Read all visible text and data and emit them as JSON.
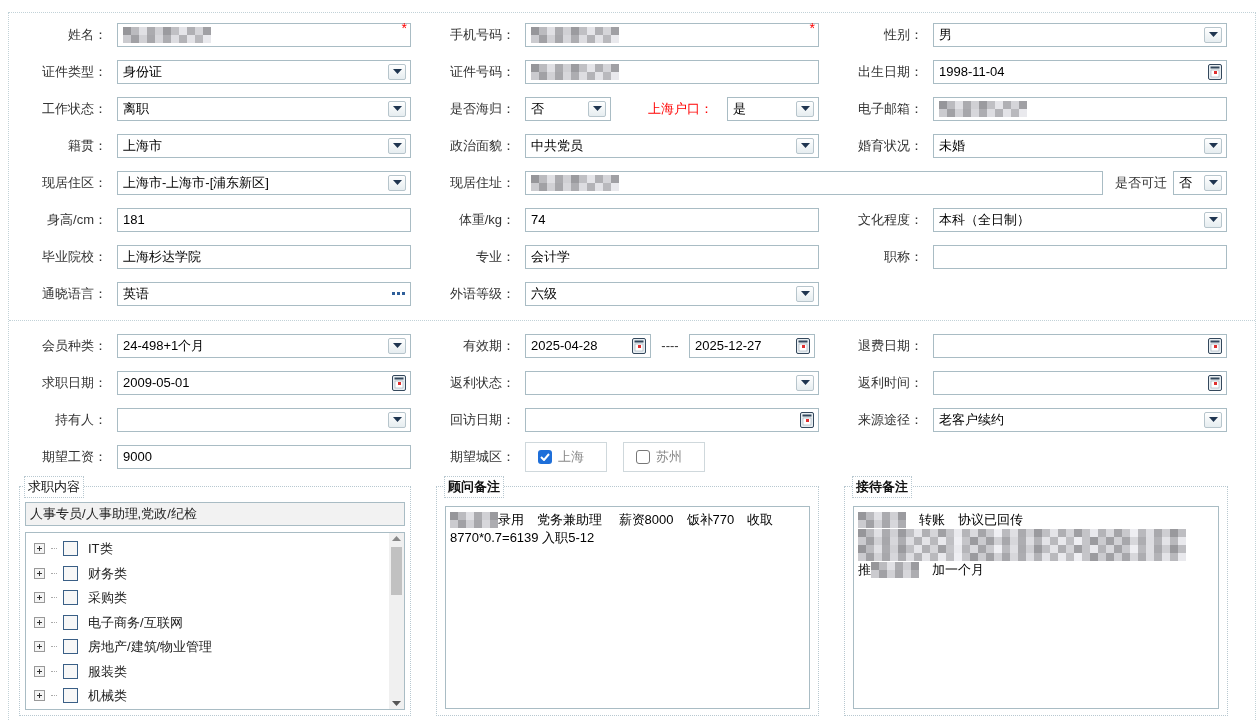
{
  "sections": [
    {
      "rows": [
        {
          "cells": [
            {
              "kind": "normal",
              "label": "姓名：",
              "field": {
                "kind": "text",
                "redacted": true,
                "required_mark": "*"
              }
            },
            {
              "kind": "normal",
              "label": "手机号码：",
              "field": {
                "kind": "text",
                "redacted": true,
                "required_mark": "*"
              }
            },
            {
              "kind": "normal",
              "label": "性别：",
              "field": {
                "kind": "select",
                "value": "男"
              }
            }
          ]
        },
        {
          "cells": [
            {
              "kind": "normal",
              "label": "证件类型：",
              "field": {
                "kind": "select",
                "value": "身份证"
              }
            },
            {
              "kind": "normal",
              "label": "证件号码：",
              "field": {
                "kind": "text",
                "redacted": true
              }
            },
            {
              "kind": "normal",
              "label": "出生日期：",
              "field": {
                "kind": "date",
                "value": "1998-11-04"
              }
            }
          ]
        },
        {
          "cells": [
            {
              "kind": "normal",
              "label": "工作状态：",
              "field": {
                "kind": "select",
                "value": "离职"
              }
            },
            {
              "kind": "pair",
              "label": "是否海归：",
              "field": {
                "kind": "select",
                "value": "否"
              },
              "label2": "上海户口：",
              "highlight2": true,
              "field2": {
                "kind": "select",
                "value": "是"
              }
            },
            {
              "kind": "normal",
              "label": "电子邮箱：",
              "field": {
                "kind": "text",
                "redacted": true
              }
            }
          ]
        },
        {
          "cells": [
            {
              "kind": "normal",
              "label": "籍贯：",
              "field": {
                "kind": "select",
                "value": "上海市"
              }
            },
            {
              "kind": "normal",
              "label": "政治面貌：",
              "field": {
                "kind": "select",
                "value": "中共党员"
              }
            },
            {
              "kind": "normal",
              "label": "婚育状况：",
              "field": {
                "kind": "select",
                "value": "未婚"
              }
            }
          ]
        },
        {
          "cells": [
            {
              "kind": "normal",
              "label": "现居住区：",
              "field": {
                "kind": "select",
                "value": "上海市-上海市-[浦东新区]"
              }
            },
            {
              "kind": "address",
              "label": "现居住址：",
              "field": {
                "kind": "text",
                "redacted": true
              },
              "label2": "是否可迁",
              "highlight2": false,
              "field2": {
                "kind": "select",
                "value": "否"
              }
            }
          ]
        },
        {
          "cells": [
            {
              "kind": "normal",
              "label": "身高/cm：",
              "field": {
                "kind": "text",
                "value": "181"
              }
            },
            {
              "kind": "normal",
              "label": "体重/kg：",
              "field": {
                "kind": "text",
                "value": "74"
              }
            },
            {
              "kind": "normal",
              "label": "文化程度：",
              "field": {
                "kind": "select",
                "value": "本科（全日制）"
              }
            }
          ]
        },
        {
          "cells": [
            {
              "kind": "normal",
              "label": "毕业院校：",
              "field": {
                "kind": "text",
                "value": "上海杉达学院"
              }
            },
            {
              "kind": "normal",
              "label": "专业：",
              "field": {
                "kind": "text",
                "value": "会计学"
              }
            },
            {
              "kind": "normal",
              "label": "职称：",
              "field": {
                "kind": "text"
              }
            }
          ]
        },
        {
          "cells": [
            {
              "kind": "normal",
              "label": "通晓语言：",
              "field": {
                "kind": "lookup",
                "value": "英语"
              }
            },
            {
              "kind": "normal",
              "label": "外语等级：",
              "field": {
                "kind": "select",
                "value": "六级"
              }
            }
          ]
        }
      ]
    },
    {
      "rows": [
        {
          "cells": [
            {
              "kind": "normal",
              "label": "会员种类：",
              "field": {
                "kind": "select",
                "value": "24-498+1个月"
              }
            },
            {
              "kind": "range",
              "label": "有效期：",
              "field": {
                "kind": "date",
                "value": "2025-04-28"
              },
              "separator": "----",
              "field2": {
                "kind": "date",
                "value": "2025-12-27"
              }
            },
            {
              "kind": "normal",
              "label": "退费日期：",
              "field": {
                "kind": "date"
              }
            }
          ]
        },
        {
          "cells": [
            {
              "kind": "normal",
              "label": "求职日期：",
              "field": {
                "kind": "date",
                "value": "2009-05-01"
              }
            },
            {
              "kind": "normal",
              "label": "返利状态：",
              "field": {
                "kind": "select"
              }
            },
            {
              "kind": "normal",
              "label": "返利时间：",
              "field": {
                "kind": "date"
              }
            }
          ]
        },
        {
          "cells": [
            {
              "kind": "normal",
              "label": "持有人：",
              "field": {
                "kind": "select"
              }
            },
            {
              "kind": "normal",
              "label": "回访日期：",
              "field": {
                "kind": "date"
              }
            },
            {
              "kind": "normal",
              "label": "来源途径：",
              "field": {
                "kind": "select",
                "value": "老客户续约"
              }
            }
          ]
        },
        {
          "cells": [
            {
              "kind": "normal",
              "label": "期望工资：",
              "field": {
                "kind": "text",
                "value": "9000"
              }
            },
            {
              "kind": "checks",
              "label": "期望城区：",
              "options": [
                {
                  "label": "上海",
                  "checked": true
                },
                {
                  "label": "苏州",
                  "checked": false
                }
              ]
            }
          ]
        }
      ]
    }
  ],
  "job_panel": {
    "legend": "求职内容",
    "value": "人事专员/人事助理,党政/纪检",
    "tree": [
      {
        "label": "IT类",
        "checked": false,
        "expanded": false
      },
      {
        "label": "财务类",
        "checked": false,
        "expanded": false
      },
      {
        "label": "采购类",
        "checked": false,
        "expanded": false
      },
      {
        "label": "电子商务/互联网",
        "checked": false,
        "expanded": false
      },
      {
        "label": "房地产/建筑/物业管理",
        "checked": false,
        "expanded": false
      },
      {
        "label": "服装类",
        "checked": false,
        "expanded": false
      },
      {
        "label": "机械类",
        "checked": false,
        "expanded": false
      }
    ]
  },
  "notes": [
    {
      "legend": "顾问备注",
      "lines": [
        [
          {
            "kind": "redacted"
          },
          {
            "kind": "text",
            "text": "录用　党务兼助理　 薪资8000　饭补770　收取"
          }
        ],
        [
          {
            "kind": "text",
            "text": "8770*0.7=6139 入职5-12"
          }
        ]
      ]
    },
    {
      "legend": "接待备注",
      "lines": [
        [
          {
            "kind": "redacted"
          },
          {
            "kind": "text",
            "text": "　转账　协议已回传"
          }
        ],
        [
          {
            "kind": "redacted"
          }
        ],
        [
          {
            "kind": "redacted"
          }
        ],
        [
          {
            "kind": "text",
            "text": "推"
          },
          {
            "kind": "redacted"
          },
          {
            "kind": "text",
            "text": "　加一个月"
          }
        ]
      ]
    }
  ]
}
